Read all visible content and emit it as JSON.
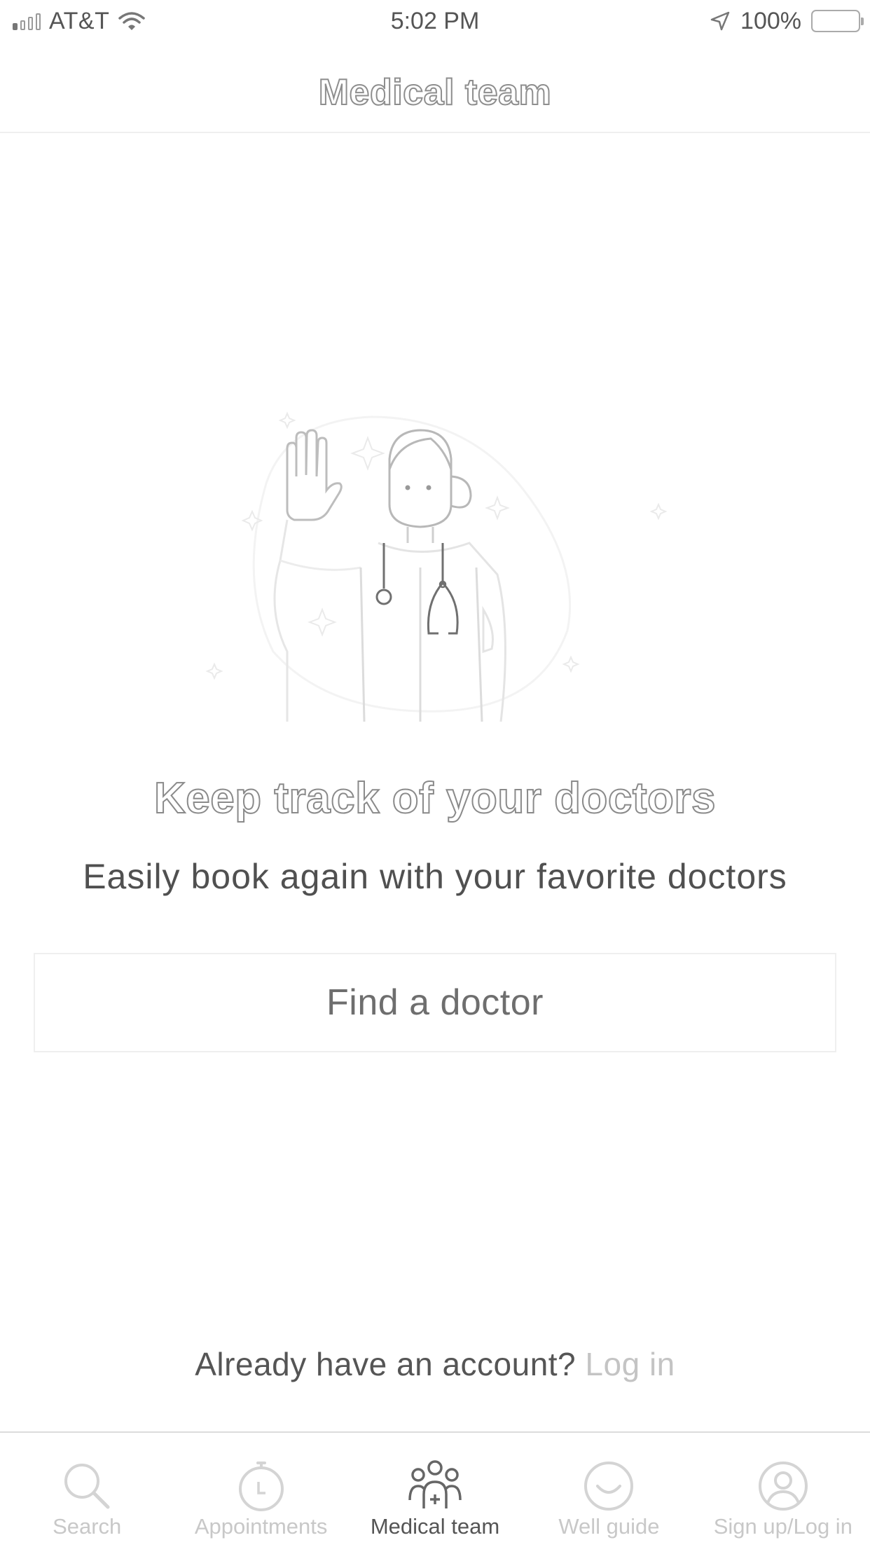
{
  "status_bar": {
    "carrier": "AT&T",
    "time": "5:02 PM",
    "battery": "100%"
  },
  "header": {
    "title": "Medical team"
  },
  "empty_state": {
    "headline": "Keep track of your doctors",
    "subtitle": "Easily book again with your favorite doctors",
    "illustration": "doctor-waving-illustration"
  },
  "actions": {
    "find_doctor_label": "Find a doctor"
  },
  "account": {
    "prompt": "Already have an account?",
    "login_label": "Log in"
  },
  "tab_bar": {
    "tabs": [
      {
        "label": "Search",
        "icon": "search-icon"
      },
      {
        "label": "Appointments",
        "icon": "clock-icon"
      },
      {
        "label": "Medical team",
        "icon": "team-icon",
        "active": true
      },
      {
        "label": "Well guide",
        "icon": "smile-icon"
      },
      {
        "label": "Sign up/Log in",
        "icon": "user-icon"
      }
    ]
  }
}
